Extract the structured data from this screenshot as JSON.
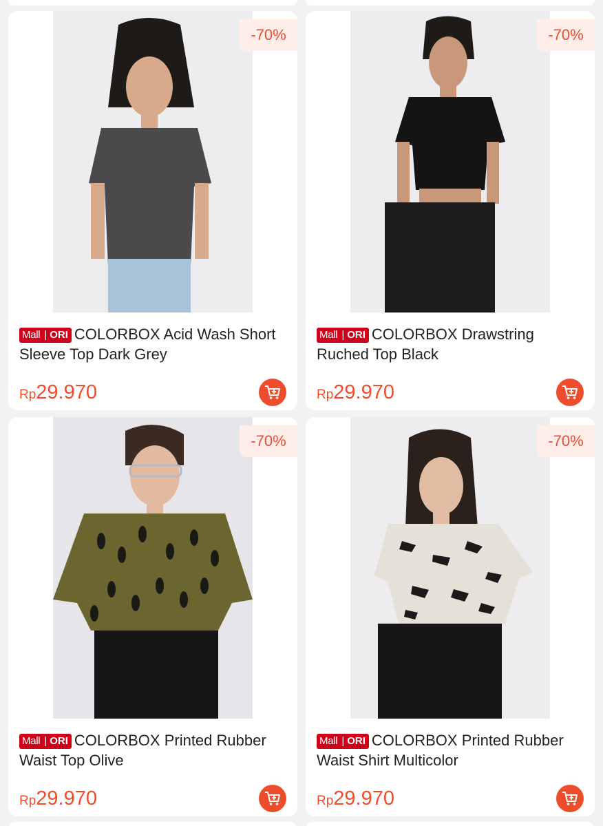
{
  "badge": {
    "mall": "Mall",
    "ori": "ORI"
  },
  "products": [
    {
      "name": "COLORBOX Acid Wash Short Sleeve Top Dark Grey",
      "discount": "-70%",
      "currency": "Rp",
      "price": "29.970",
      "shirt_color": "#4a4a4c",
      "pants_color": "#a8c2da"
    },
    {
      "name": "COLORBOX Drawstring Ruched Top Black",
      "discount": "-70%",
      "currency": "Rp",
      "price": "29.970",
      "shirt_color": "#141414",
      "pants_color": "#1c1c1c"
    },
    {
      "name": "COLORBOX Printed Rubber Waist Top Olive",
      "discount": "-70%",
      "currency": "Rp",
      "price": "29.970",
      "shirt_color": "#6b6630",
      "pants_color": "#161616"
    },
    {
      "name": "COLORBOX Printed Rubber Waist Shirt Multicolor",
      "discount": "-70%",
      "currency": "Rp",
      "price": "29.970",
      "shirt_color": "#e6e1d8",
      "pants_color": "#161616"
    }
  ],
  "colors": {
    "accent": "#ee4d2d",
    "mall_badge": "#d0011b",
    "discount_bg": "#fdeee9"
  }
}
